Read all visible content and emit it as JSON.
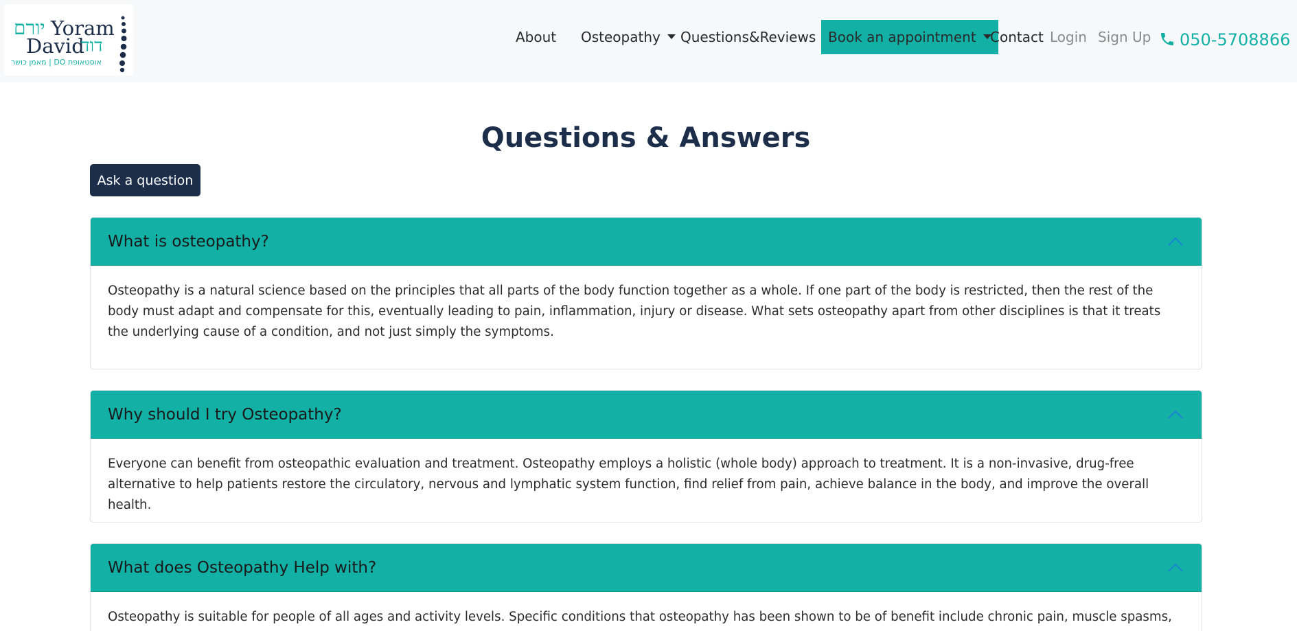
{
  "brand": {
    "name_en_line1": "Yoram",
    "name_en_line2": "David",
    "name_he_line1": "יורם",
    "name_he_line2": "דוד",
    "tagline_he": "אוסטאופת DO | מאמן כושר"
  },
  "nav": {
    "about": "About",
    "osteopathy": "Osteopathy",
    "questions_reviews": "Questions&Reviews",
    "book": "Book an appointment",
    "contact": "Contact",
    "login": "Login",
    "signup": "Sign Up",
    "phone": "050-5708866"
  },
  "main": {
    "title": "Questions & Answers",
    "ask_button": "Ask a question",
    "faqs": [
      {
        "question": "What is osteopathy?",
        "answer": "Osteopathy is a natural science based on the principles that all parts of the body function together as a whole. If one part of the body is restricted, then the rest of the body must adapt and compensate for this, eventually leading to pain, inflammation, injury or disease. What sets osteopathy apart from other disciplines is that it treats the underlying cause of a condition, and not just simply the symptoms."
      },
      {
        "question": "Why should I try Osteopathy?",
        "answer": "Everyone can benefit from osteopathic evaluation and treatment. Osteopathy employs a holistic (whole body) approach to treatment. It is a non-invasive, drug-free alternative to help patients restore the circulatory, nervous and lymphatic system function, find relief from pain, achieve balance in the body, and improve the overall health."
      },
      {
        "question": "What does Osteopathy Help with?",
        "answer": "Osteopathy is suitable for people of all ages and activity levels. Specific conditions that osteopathy has been shown to be of benefit include chronic pain, muscle spasms, sports-"
      }
    ]
  },
  "colors": {
    "teal": "#13b0a5",
    "navy": "#1c2e4a",
    "navbar_bg": "#f7f8f9"
  },
  "icons": {
    "phone": "phone-icon",
    "caret": "caret-down-icon",
    "chevron": "chevron-up-icon"
  }
}
